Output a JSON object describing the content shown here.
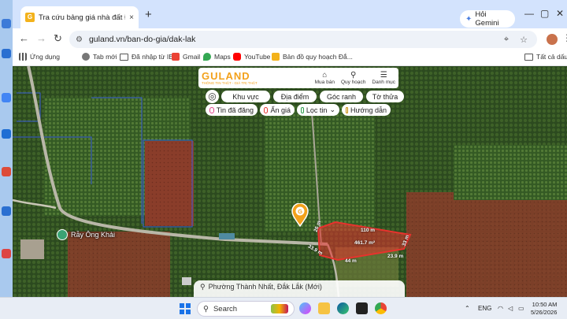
{
  "browser": {
    "tab_title": "Tra cứu bảng giá nhà đất Đắk Lắk",
    "tab_close": "×",
    "new_tab": "+",
    "gemini_label": "Hỏi Gemini",
    "url": "guland.vn/ban-do-gia/dak-lak",
    "window_controls": {
      "minimize": "—",
      "maximize": "▢",
      "close": "✕"
    }
  },
  "bookmarks": [
    {
      "label": "Ứng dụng",
      "icon": "apps-grid-icon"
    },
    {
      "label": "Tab mới",
      "icon": "chrome-icon"
    },
    {
      "label": "Đã nhập từ IE",
      "icon": "folder-icon"
    },
    {
      "label": "Gmail",
      "icon": "gmail-icon"
    },
    {
      "label": "Maps",
      "icon": "maps-icon"
    },
    {
      "label": "YouTube",
      "icon": "youtube-icon"
    },
    {
      "label": "Bản đồ quy hoạch Đắ...",
      "icon": "guland-icon"
    }
  ],
  "bookmarks_all": "Tất cả dấu tra",
  "guland": {
    "logo": "GULAND",
    "tagline": "THÔNG TIN THẬT - GIÁ TRỊ THẬT",
    "menu": [
      {
        "label": "Mua bán",
        "icon": "store-icon"
      },
      {
        "label": "Quy hoạch",
        "icon": "map-search-icon"
      },
      {
        "label": "Danh mục",
        "icon": "hamburger-icon"
      }
    ],
    "filters_row1": [
      "Khu vực",
      "Địa điểm",
      "Góc ranh",
      "Tờ thửa"
    ],
    "filters_row2": [
      {
        "label": "Tin đã đăng",
        "color": "#e0408a"
      },
      {
        "label": "Ẩn giá",
        "color": "#e53935"
      },
      {
        "label": "Lọc tin",
        "color": "#2e9d4b"
      },
      {
        "label": "Hướng dẫn",
        "color": "#c88a00"
      }
    ],
    "filter_dropdown": "⌄",
    "locate_icon": "◎",
    "parcel": {
      "area": "461.7 m²",
      "edges": [
        "110 m",
        "26 m",
        "33.9 m",
        "44 m",
        "23.9 m",
        "33 m"
      ]
    },
    "place": "Rẫy Ông Khải",
    "bottom_text": "Phường Thành Nhất, Đắk Lắk (Mới)"
  },
  "taskbar": {
    "search_placeholder": "Search",
    "lang": "ENG",
    "time": "10:50 AM",
    "date": "5/26/2026"
  },
  "colors": {
    "parcel_stroke": "#e8322d",
    "guland_orange": "#f3a11b",
    "tab_strip": "#d3e3fd"
  }
}
